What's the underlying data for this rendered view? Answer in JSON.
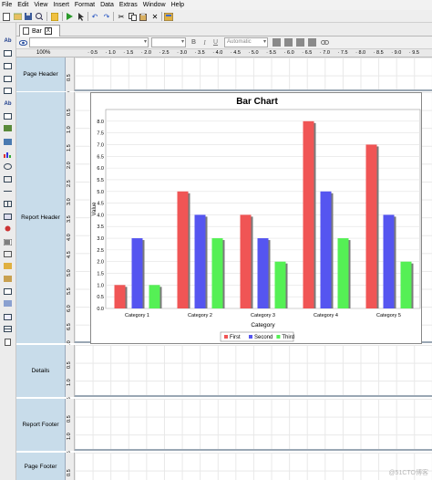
{
  "menu": [
    "File",
    "Edit",
    "View",
    "Insert",
    "Format",
    "Data",
    "Extras",
    "Window",
    "Help"
  ],
  "toolbar_icons": [
    "new-icon",
    "open-icon",
    "save-icon",
    "print-preview-icon",
    "report-icon",
    "run-icon",
    "pointer-icon",
    "undo-icon",
    "redo-icon",
    "cut-icon",
    "copy-icon",
    "paste-icon",
    "delete-icon",
    "properties-icon"
  ],
  "tab": {
    "label": "Bar",
    "close": "X"
  },
  "format": {
    "font_placeholder": "",
    "size_placeholder": "",
    "color_value": "Automatic"
  },
  "zoom": "100%",
  "ruler_ticks": [
    "0.5",
    "1.0",
    "1.5",
    "2.0",
    "2.5",
    "3.0",
    "3.5",
    "4.0",
    "4.5",
    "5.0",
    "5.5",
    "6.0",
    "6.5",
    "7.0",
    "7.5",
    "8.0",
    "8.5",
    "9.0",
    "9.5"
  ],
  "sections": {
    "page_header": "Page Header",
    "report_header": "Report Header",
    "details": "Details",
    "report_footer": "Report Footer",
    "page_footer": "Page Footer"
  },
  "vruler": {
    "page_header": [
      "0.5",
      "1.0"
    ],
    "report_header": [
      "0.5",
      "1.0",
      "1.5",
      "2.0",
      "2.5",
      "3.0",
      "3.5",
      "4.0",
      "4.5",
      "5.0",
      "5.5",
      "6.0",
      "6.5",
      "7.0"
    ],
    "details": [
      "0.5",
      "1.0",
      "1.5"
    ],
    "report_footer": [
      "0.5",
      "1.0",
      "1.5"
    ],
    "page_footer": [
      "0.5"
    ]
  },
  "watermark": "@51CTO博客",
  "chart_data": {
    "type": "bar",
    "title": "Bar Chart",
    "xlabel": "Category",
    "ylabel": "Value",
    "categories": [
      "Category 1",
      "Category 2",
      "Category 3",
      "Category 4",
      "Category 5"
    ],
    "series": [
      {
        "name": "First",
        "color": "#f05555",
        "values": [
          1.0,
          5.0,
          4.0,
          8.0,
          7.0
        ]
      },
      {
        "name": "Second",
        "color": "#5555f0",
        "values": [
          3.0,
          4.0,
          3.0,
          5.0,
          4.0
        ]
      },
      {
        "name": "Third",
        "color": "#55f055",
        "values": [
          1.0,
          3.0,
          2.0,
          3.0,
          2.0
        ]
      }
    ],
    "ylim": [
      0,
      8.5
    ],
    "yticks": [
      "0.0",
      "0.5",
      "1.0",
      "1.5",
      "2.0",
      "2.5",
      "3.0",
      "3.5",
      "4.0",
      "4.5",
      "5.0",
      "5.5",
      "6.0",
      "6.5",
      "7.0",
      "7.5",
      "8.0"
    ],
    "grid": true,
    "legend": "bottom"
  }
}
